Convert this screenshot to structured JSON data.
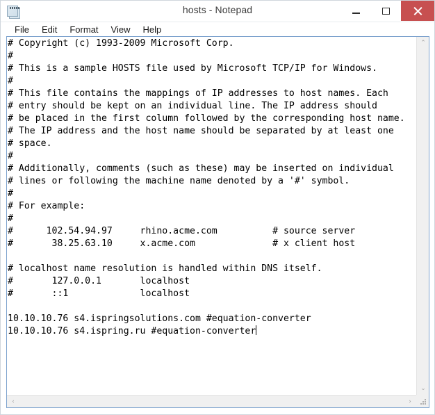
{
  "window": {
    "title": "hosts - Notepad",
    "icon": "notepad-icon",
    "controls": {
      "minimize_label": "–",
      "maximize_label": "□",
      "close_label": "×"
    },
    "close_button_color": "#c75050",
    "border_color": "#7da2ce"
  },
  "menu": {
    "items": [
      {
        "label": "File"
      },
      {
        "label": "Edit"
      },
      {
        "label": "Format"
      },
      {
        "label": "View"
      },
      {
        "label": "Help"
      }
    ]
  },
  "editor": {
    "font": "monospace",
    "text": "# Copyright (c) 1993-2009 Microsoft Corp.\n#\n# This is a sample HOSTS file used by Microsoft TCP/IP for Windows.\n#\n# This file contains the mappings of IP addresses to host names. Each\n# entry should be kept on an individual line. The IP address should\n# be placed in the first column followed by the corresponding host name.\n# The IP address and the host name should be separated by at least one\n# space.\n#\n# Additionally, comments (such as these) may be inserted on individual\n# lines or following the machine name denoted by a '#' symbol.\n#\n# For example:\n#\n#      102.54.94.97     rhino.acme.com          # source server\n#       38.25.63.10     x.acme.com              # x client host\n\n# localhost name resolution is handled within DNS itself.\n#\t127.0.0.1       localhost\n#\t::1             localhost\n\n10.10.10.76 s4.ispringsolutions.com #equation-converter\n10.10.10.76 s4.ispring.ru #equation-converter",
    "lines": [
      "# Copyright (c) 1993-2009 Microsoft Corp.",
      "#",
      "# This is a sample HOSTS file used by Microsoft TCP/IP for Windows.",
      "#",
      "# This file contains the mappings of IP addresses to host names. Each",
      "# entry should be kept on an individual line. The IP address should",
      "# be placed in the first column followed by the corresponding host name.",
      "# The IP address and the host name should be separated by at least one",
      "# space.",
      "#",
      "# Additionally, comments (such as these) may be inserted on individual",
      "# lines or following the machine name denoted by a '#' symbol.",
      "#",
      "# For example:",
      "#",
      "#      102.54.94.97     rhino.acme.com          # source server",
      "#       38.25.63.10     x.acme.com              # x client host",
      "",
      "# localhost name resolution is handled within DNS itself.",
      "#       127.0.0.1       localhost",
      "#       ::1             localhost",
      "",
      "10.10.10.76 s4.ispringsolutions.com #equation-converter",
      "10.10.10.76 s4.ispring.ru #equation-converter"
    ],
    "caret_line": 23,
    "caret_visible": true
  },
  "scrollbars": {
    "vertical": {
      "up_arrow": "⌃",
      "down_arrow": "⌄"
    },
    "horizontal": {
      "left_arrow": "‹",
      "right_arrow": "›"
    },
    "resize_grip": "resize-grip"
  }
}
